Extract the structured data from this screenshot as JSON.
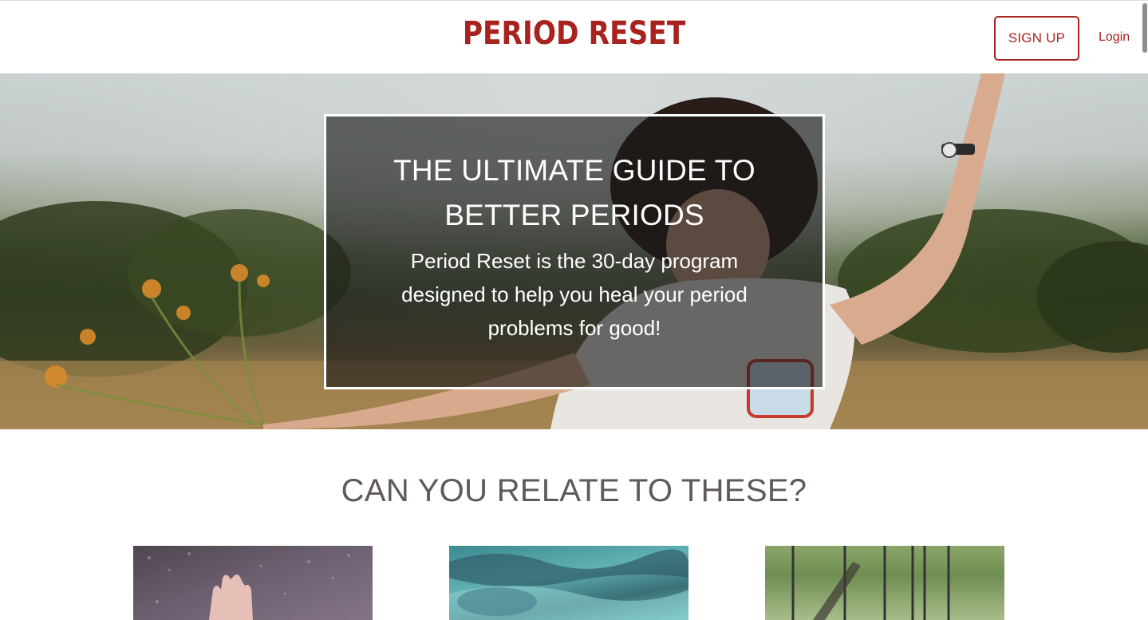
{
  "header": {
    "logo_text": "PERIOD RESET",
    "signup_label": "SIGN UP",
    "login_label": "Login",
    "brand_color": "#a8231f"
  },
  "hero": {
    "title": "THE ULTIMATE GUIDE TO BETTER PERIODS",
    "subtitle": "Period Reset is the 30-day program designed to help you heal your period problems for good!",
    "image": "woman-jumping-in-field-photo"
  },
  "relate": {
    "title": "CAN YOU RELATE TO THESE?",
    "cards": [
      {
        "image": "hand-on-rainy-window-photo"
      },
      {
        "image": "ocean-waves-photo"
      },
      {
        "image": "playground-swings-photo"
      }
    ]
  }
}
